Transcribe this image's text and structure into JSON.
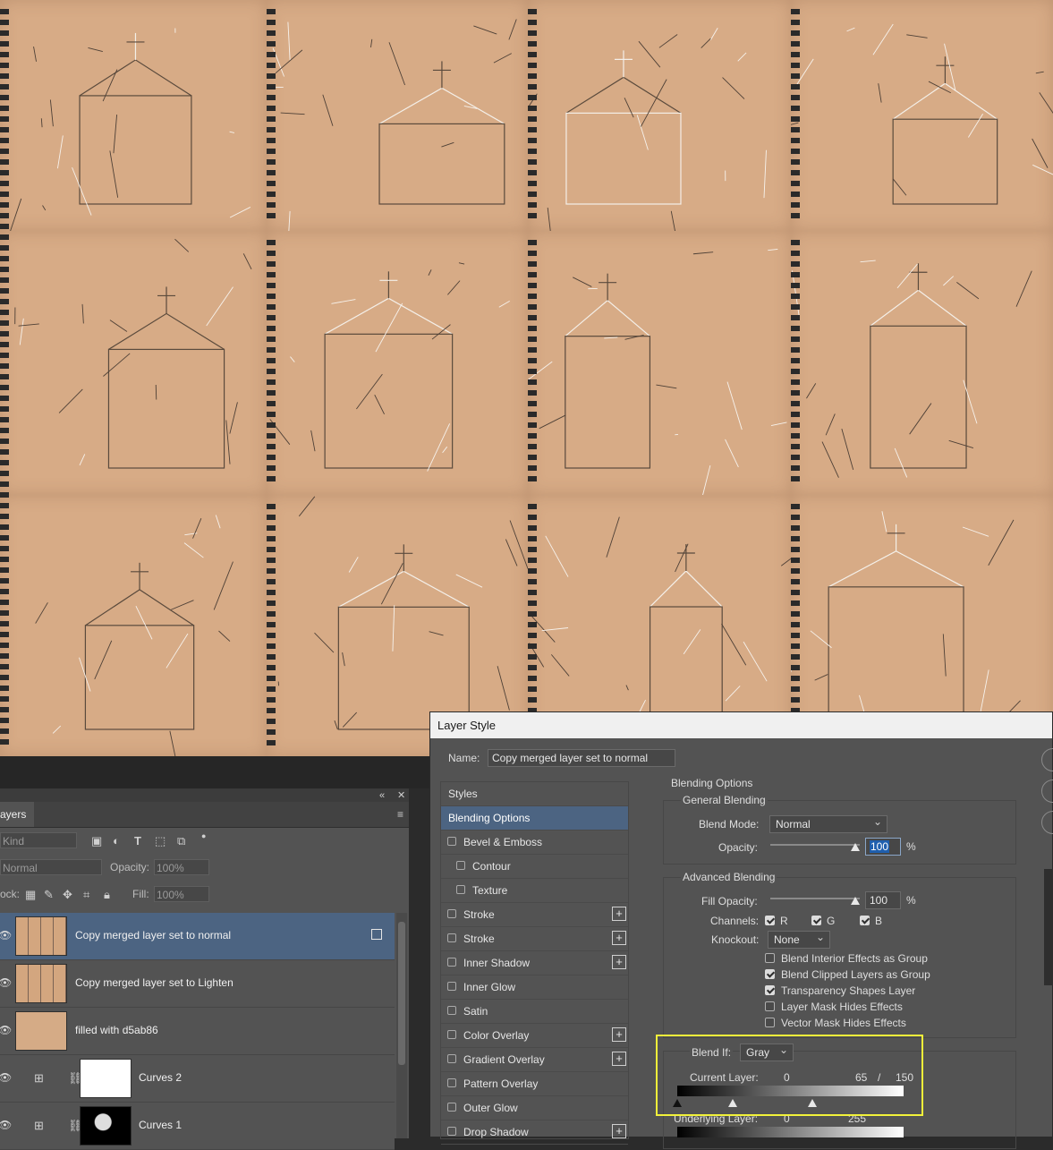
{
  "layers_panel": {
    "collapse_glyph": "«",
    "close_glyph": "✕",
    "tab_label": "ayers",
    "filter_kind": "Kind",
    "blend_mode": "Normal",
    "opacity_label": "Opacity:",
    "opacity_value": "100%",
    "lock_label": "ock:",
    "fill_label": "Fill:",
    "fill_value": "100%",
    "layers": [
      {
        "name": "Copy merged layer set to normal",
        "selected": true,
        "thumb": "sketch"
      },
      {
        "name": "Copy merged layer set to Lighten",
        "selected": false,
        "thumb": "sketch"
      },
      {
        "name": "filled with d5ab86",
        "selected": false,
        "thumb": "fill",
        "fill_color": "#d5ab86"
      },
      {
        "name": "Curves 2",
        "selected": false,
        "thumb": "white-mask"
      },
      {
        "name": "Curves 1",
        "selected": false,
        "thumb": "black-mask"
      }
    ]
  },
  "dialog": {
    "title": "Layer Style",
    "name_label": "Name:",
    "name_value": "Copy merged layer set to normal",
    "styles": [
      {
        "label": "Styles",
        "checkbox": false,
        "plus": false,
        "header": true
      },
      {
        "label": "Blending Options",
        "checkbox": false,
        "plus": false,
        "active": true
      },
      {
        "label": "Bevel & Emboss",
        "checkbox": true,
        "plus": false
      },
      {
        "label": "Contour",
        "checkbox": true,
        "plus": false,
        "indent": true
      },
      {
        "label": "Texture",
        "checkbox": true,
        "plus": false,
        "indent": true
      },
      {
        "label": "Stroke",
        "checkbox": true,
        "plus": true
      },
      {
        "label": "Stroke",
        "checkbox": true,
        "plus": true
      },
      {
        "label": "Inner Shadow",
        "checkbox": true,
        "plus": true
      },
      {
        "label": "Inner Glow",
        "checkbox": true,
        "plus": false
      },
      {
        "label": "Satin",
        "checkbox": true,
        "plus": false
      },
      {
        "label": "Color Overlay",
        "checkbox": true,
        "plus": true
      },
      {
        "label": "Gradient Overlay",
        "checkbox": true,
        "plus": true
      },
      {
        "label": "Pattern Overlay",
        "checkbox": true,
        "plus": false
      },
      {
        "label": "Outer Glow",
        "checkbox": true,
        "plus": false
      },
      {
        "label": "Drop Shadow",
        "checkbox": true,
        "plus": true
      }
    ],
    "blending_options_title": "Blending Options",
    "general_blending_title": "General Blending",
    "blend_mode_label": "Blend Mode:",
    "blend_mode_value": "Normal",
    "opacity_label": "Opacity:",
    "opacity_value": "100",
    "percent": "%",
    "advanced_blending_title": "Advanced Blending",
    "fill_opacity_label": "Fill Opacity:",
    "fill_opacity_value": "100",
    "channels_label": "Channels:",
    "channels": [
      {
        "label": "R",
        "checked": true
      },
      {
        "label": "G",
        "checked": true
      },
      {
        "label": "B",
        "checked": true
      }
    ],
    "knockout_label": "Knockout:",
    "knockout_value": "None",
    "options": [
      {
        "label": "Blend Interior Effects as Group",
        "checked": false
      },
      {
        "label": "Blend Clipped Layers as Group",
        "checked": true
      },
      {
        "label": "Transparency Shapes Layer",
        "checked": true
      },
      {
        "label": "Layer Mask Hides Effects",
        "checked": false
      },
      {
        "label": "Vector Mask Hides Effects",
        "checked": false
      }
    ],
    "blend_if_label": "Blend If:",
    "blend_if_value": "Gray",
    "current_layer_label": "Current Layer:",
    "current_layer_low": "0",
    "current_layer_mid": "65",
    "current_layer_sep": "/",
    "current_layer_high": "150",
    "underlying_layer_label": "Underlying Layer:",
    "underlying_low": "0",
    "underlying_high": "255"
  },
  "colors": {
    "paper": "#d7ab86",
    "highlight": "#f2f23a",
    "selection": "#4c6482"
  }
}
